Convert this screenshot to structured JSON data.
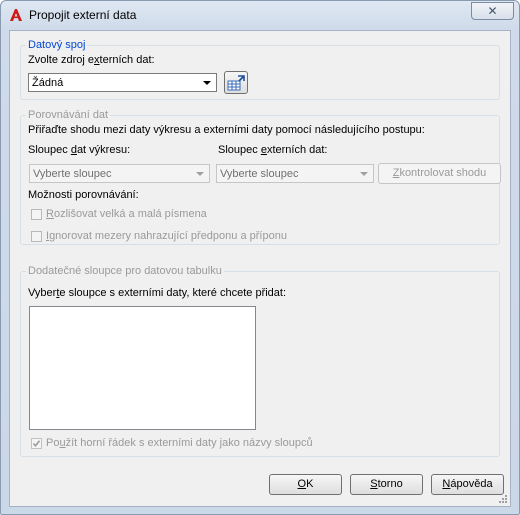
{
  "window": {
    "title": "Propojit externí data",
    "close_glyph": "✕"
  },
  "data_link": {
    "legend": "Datový spoj",
    "source_label": "Zvolte zdroj externích dat:",
    "source_label_parts": [
      "Zvolte zdroj e",
      "x",
      "terních dat:"
    ],
    "source_value": "Žádná",
    "new_link_icon": "data-link-manager-icon"
  },
  "matching": {
    "legend": "Porovnávání dat",
    "instructions": "Přiřaďte shodu mezi daty výkresu a externími daty pomocí následujícího postupu:",
    "drawing_column_label": "Sloupec dat výkresu:",
    "drawing_column_parts": [
      "Sloupec ",
      "d",
      "at výkresu:"
    ],
    "external_column_label": "Sloupec externích dat:",
    "external_column_parts": [
      "Sloupec ",
      "e",
      "xterních dat:"
    ],
    "drawing_column_value": "Vyberte sloupec",
    "external_column_value": "Vyberte sloupec",
    "check_button": "Zkontrolovat shodu",
    "check_button_parts": [
      "Z",
      "kontrolovat shodu"
    ],
    "options_label": "Možnosti porovnávání:",
    "case_sensitive": "Rozlišovat velká a malá písmena",
    "case_sensitive_parts": [
      "R",
      "ozlišovat velká a malá písmena"
    ],
    "ignore_spaces": "Ignorovat mezery nahrazující předponu a příponu",
    "ignore_spaces_parts": [
      "I",
      "gnorovat mezery nahrazující předponu a příponu"
    ]
  },
  "additional": {
    "legend": "Dodatečné sloupce pro datovou tabulku",
    "select_label": "Vyberte sloupce s externími daty, které chcete přidat:",
    "select_label_parts": [
      "Vyber",
      "t",
      "e sloupce s externími daty, které chcete přidat:"
    ],
    "use_header": "Použít horní řádek s externími daty jako názvy sloupců",
    "use_header_parts": [
      "Po",
      "u",
      "žít horní řádek s externími daty jako názvy sloupců"
    ],
    "use_header_checked": true
  },
  "buttons": {
    "ok": "OK",
    "ok_parts": [
      "O",
      "K"
    ],
    "cancel": "Storno",
    "cancel_parts": [
      "S",
      "torno"
    ],
    "help": "Nápověda",
    "help_parts": [
      "N",
      "ápověda"
    ]
  }
}
